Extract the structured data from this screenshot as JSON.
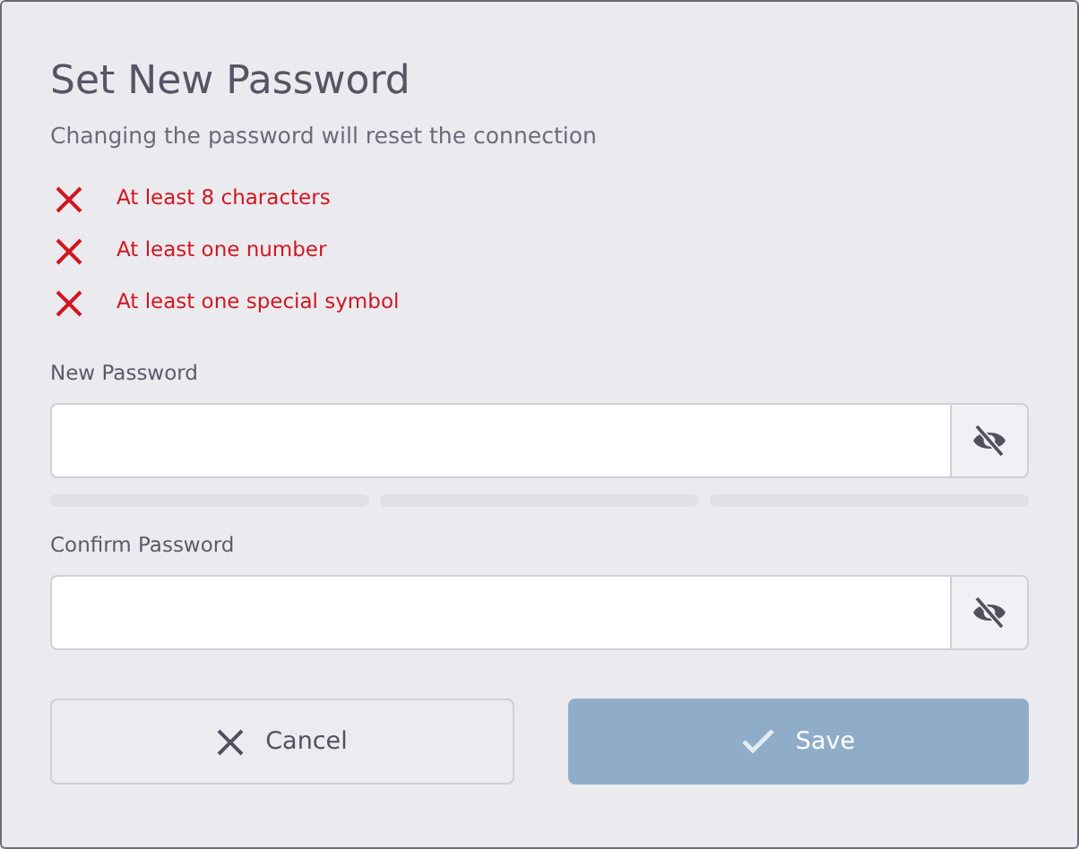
{
  "dialog": {
    "title": "Set New Password",
    "subtitle": "Changing the password will reset the connection"
  },
  "requirements": [
    {
      "text": "At least 8 characters",
      "met": false
    },
    {
      "text": "At least one number",
      "met": false
    },
    {
      "text": "At least one special symbol",
      "met": false
    }
  ],
  "fields": [
    {
      "label": "New Password",
      "visible": false,
      "strength": {
        "level": 0
      }
    },
    {
      "label": "Confirm Password",
      "visible": false
    }
  ],
  "buttons": [
    {
      "kind": "cancel",
      "label": "Cancel"
    },
    {
      "kind": "save",
      "label": "Save",
      "disabled": true
    }
  ]
}
